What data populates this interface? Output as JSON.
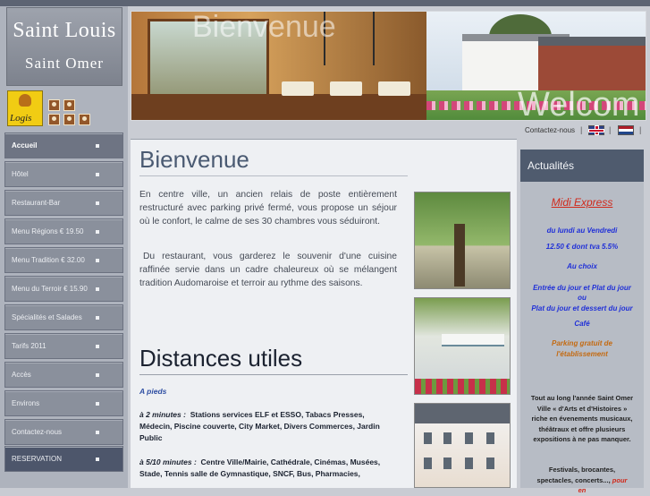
{
  "logo": {
    "line1": "Saint Louis",
    "line2": "Saint Omer",
    "logis": "Logis"
  },
  "menu": [
    {
      "label": "Accueil"
    },
    {
      "label": "Hôtel"
    },
    {
      "label": "Restaurant-Bar"
    },
    {
      "label": "Menu Régions € 19.50"
    },
    {
      "label": "Menu Tradition € 32.00"
    },
    {
      "label": "Menu du Terroir € 15.90"
    },
    {
      "label": "Spécialités et Salades"
    },
    {
      "label": "Tarifs 2011"
    },
    {
      "label": "Accès"
    },
    {
      "label": "Environs"
    },
    {
      "label": "Contactez-nous"
    },
    {
      "label": "RESERVATION"
    }
  ],
  "header": {
    "overlay_left": "Bienvenue",
    "overlay_right": "Welcom"
  },
  "topnav": {
    "contact": "Contactez-nous",
    "sep": "|"
  },
  "main": {
    "title": "Bienvenue",
    "p1": "En centre ville, un ancien relais de poste entièrement restructuré avec parking privé fermé, vous propose un séjour où le confort, le calme de ses 30 chambres vous séduiront.",
    "p2": "Du restaurant, vous garderez le souvenir d'une cuisine raffinée servie dans un cadre chaleureux où se mélangent tradition Audomaroise et terroir au rythme des saisons.",
    "dist_title": "Distances utiles",
    "a_pieds": "A pieds",
    "d1_lead": "à 2 minutes :",
    "d1_text": "Stations services ELF et ESSO, Tabacs Presses, Médecin, Piscine couverte, City Market, Divers Commerces, Jardin Public",
    "d2_lead": "à 5/10 minutes :",
    "d2_text": "Centre Ville/Mairie, Cathédrale, Cinémas, Musées, Stade, Tennis salle de Gymnastique, SNCF, Bus, Pharmacies,"
  },
  "actualites": {
    "title": "Actualités",
    "midi": "Midi Express",
    "l1": "du lundi au Vendredi",
    "l2": "12.50 € dont tva 5.5%",
    "l3": "Au choix",
    "l4": "Entrée du jour et Plat du jour",
    "l5": "ou",
    "l6": "Plat du jour et dessert du jour",
    "l7": "Café",
    "parking": "Parking gratuit de l'établissement",
    "events": "Tout au long l'année Saint Omer Ville « d'Arts et d'Histoires » riche en évenements musicaux, théâtraux et offre plusieurs expositions à ne pas manquer.",
    "festivals": "Festivals, brocantes, spectacles, concerts...,",
    "pour_en": "pour en"
  }
}
